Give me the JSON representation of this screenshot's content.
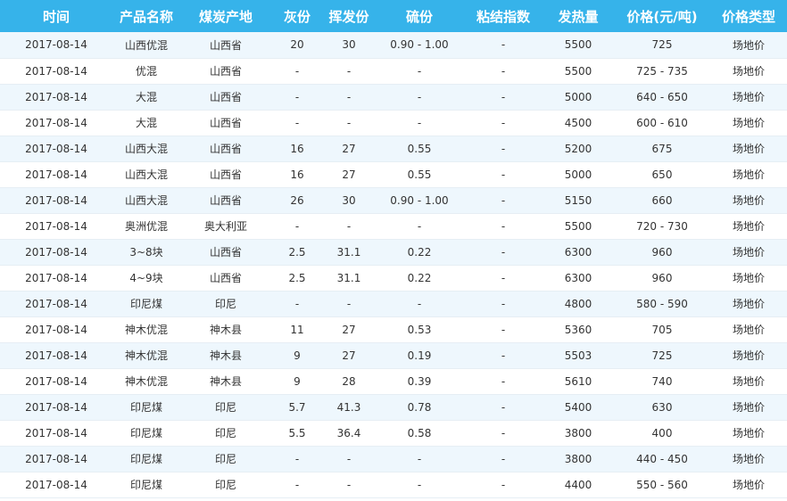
{
  "table": {
    "headers": [
      "时间",
      "产品名称",
      "煤炭产地",
      "灰份",
      "挥发份",
      "硫份",
      "粘结指数",
      "发热量",
      "价格(元/吨)",
      "价格类型"
    ],
    "rows": [
      [
        "2017-08-14",
        "山西优混",
        "山西省",
        "20",
        "30",
        "0.90 - 1.00",
        "-",
        "5500",
        "725",
        "场地价"
      ],
      [
        "2017-08-14",
        "优混",
        "山西省",
        "-",
        "-",
        "-",
        "-",
        "5500",
        "725 - 735",
        "场地价"
      ],
      [
        "2017-08-14",
        "大混",
        "山西省",
        "-",
        "-",
        "-",
        "-",
        "5000",
        "640 - 650",
        "场地价"
      ],
      [
        "2017-08-14",
        "大混",
        "山西省",
        "-",
        "-",
        "-",
        "-",
        "4500",
        "600 - 610",
        "场地价"
      ],
      [
        "2017-08-14",
        "山西大混",
        "山西省",
        "16",
        "27",
        "0.55",
        "-",
        "5200",
        "675",
        "场地价"
      ],
      [
        "2017-08-14",
        "山西大混",
        "山西省",
        "16",
        "27",
        "0.55",
        "-",
        "5000",
        "650",
        "场地价"
      ],
      [
        "2017-08-14",
        "山西大混",
        "山西省",
        "26",
        "30",
        "0.90 - 1.00",
        "-",
        "5150",
        "660",
        "场地价"
      ],
      [
        "2017-08-14",
        "奥洲优混",
        "奥大利亚",
        "-",
        "-",
        "-",
        "-",
        "5500",
        "720 - 730",
        "场地价"
      ],
      [
        "2017-08-14",
        "3~8块",
        "山西省",
        "2.5",
        "31.1",
        "0.22",
        "-",
        "6300",
        "960",
        "场地价"
      ],
      [
        "2017-08-14",
        "4~9块",
        "山西省",
        "2.5",
        "31.1",
        "0.22",
        "-",
        "6300",
        "960",
        "场地价"
      ],
      [
        "2017-08-14",
        "印尼煤",
        "印尼",
        "-",
        "-",
        "-",
        "-",
        "4800",
        "580 - 590",
        "场地价"
      ],
      [
        "2017-08-14",
        "神木优混",
        "神木县",
        "11",
        "27",
        "0.53",
        "-",
        "5360",
        "705",
        "场地价"
      ],
      [
        "2017-08-14",
        "神木优混",
        "神木县",
        "9",
        "27",
        "0.19",
        "-",
        "5503",
        "725",
        "场地价"
      ],
      [
        "2017-08-14",
        "神木优混",
        "神木县",
        "9",
        "28",
        "0.39",
        "-",
        "5610",
        "740",
        "场地价"
      ],
      [
        "2017-08-14",
        "印尼煤",
        "印尼",
        "5.7",
        "41.3",
        "0.78",
        "-",
        "5400",
        "630",
        "场地价"
      ],
      [
        "2017-08-14",
        "印尼煤",
        "印尼",
        "5.5",
        "36.4",
        "0.58",
        "-",
        "3800",
        "400",
        "场地价"
      ],
      [
        "2017-08-14",
        "印尼煤",
        "印尼",
        "-",
        "-",
        "-",
        "-",
        "3800",
        "440 - 450",
        "场地价"
      ],
      [
        "2017-08-14",
        "印尼煤",
        "印尼",
        "-",
        "-",
        "-",
        "-",
        "4400",
        "550 - 560",
        "场地价"
      ]
    ]
  },
  "colors": {
    "header_bg": "#36b3ea",
    "header_text": "#ffffff",
    "row_alt_bg": "#eef7fd",
    "row_bg": "#ffffff",
    "row_text": "#333333"
  }
}
